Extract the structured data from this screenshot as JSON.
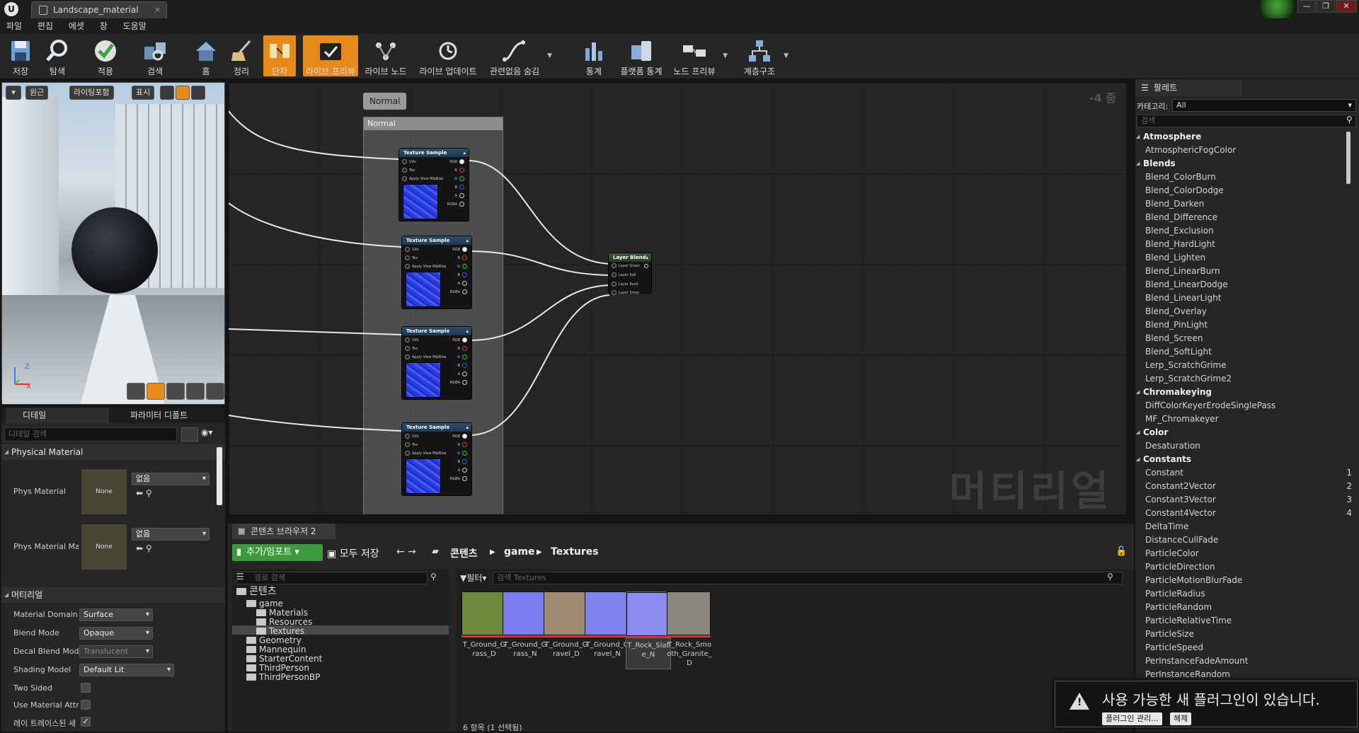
{
  "window": {
    "tab_title": "Landscape_material",
    "tab_close": "×",
    "logo": "U",
    "win_buttons": [
      "—",
      "❐",
      "✕"
    ]
  },
  "menu": [
    "파일",
    "편집",
    "에셋",
    "창",
    "도움말"
  ],
  "toolbar": [
    {
      "label": "저장",
      "icon": "save-icon"
    },
    {
      "label": "탐색",
      "icon": "browse-icon"
    },
    {
      "label": "적용",
      "icon": "apply-icon"
    },
    {
      "label": "검색",
      "icon": "find-icon"
    },
    {
      "label": "홈",
      "icon": "home-icon"
    },
    {
      "label": "정리",
      "icon": "clean-icon"
    },
    {
      "label": "단자",
      "icon": "connectors-icon",
      "active": true
    },
    {
      "label": "라이브 프리뷰",
      "icon": "live-preview-icon",
      "active": true
    },
    {
      "label": "라이브 노드",
      "icon": "live-nodes-icon"
    },
    {
      "label": "라이브 업데이트",
      "icon": "live-update-icon"
    },
    {
      "label": "관련없음 숨김",
      "icon": "hide-unrelated-icon"
    },
    {
      "label": "통계",
      "icon": "stats-icon"
    },
    {
      "label": "플랫폼 통계",
      "icon": "platform-stats-icon"
    },
    {
      "label": "노드 프리뷰",
      "icon": "node-preview-icon"
    },
    {
      "label": "계층구조",
      "icon": "hierarchy-icon"
    }
  ],
  "viewport": {
    "btn_perspective": "원근",
    "btn_lit": "라이팅포함",
    "btn_show": "표시",
    "axis_z": "Z",
    "axis_x": "X"
  },
  "details": {
    "tab_details": "디테일",
    "tab_params": "파라미터 디폴트",
    "search_placeholder": "디테일 검색",
    "section_physical": "Physical Material",
    "phys_material": {
      "label": "Phys Material",
      "thumb": "None",
      "value": "없음"
    },
    "phys_material_map": {
      "label": "Phys Material Ma",
      "thumb": "None",
      "value": "없음"
    },
    "section_material": "머티리얼",
    "material_domain": {
      "label": "Material Domain",
      "value": "Surface"
    },
    "blend_mode": {
      "label": "Blend Mode",
      "value": "Opaque"
    },
    "decal_blend_mode": {
      "label": "Decal Blend Mode",
      "value": "Translucent"
    },
    "shading_model": {
      "label": "Shading Model",
      "value": "Default Lit"
    },
    "two_sided": {
      "label": "Two Sided",
      "checked": false
    },
    "use_material_attr": {
      "label": "Use Material Attri",
      "checked": false
    },
    "raytraced": {
      "label": "레이 트레이스된 새",
      "checked": true,
      "mark": "✓"
    }
  },
  "graph": {
    "zoom": "-4 줌",
    "watermark": "머티리얼",
    "comment_tag": "Normal",
    "comment_title": "Normal",
    "texture_nodes": [
      {
        "title": "Texture Sample",
        "inputs": [
          "UVs",
          "Tex",
          "Apply View MipBias"
        ],
        "outputs": [
          "RGB",
          "R",
          "G",
          "B",
          "A",
          "RGBA"
        ]
      },
      {
        "title": "Texture Sample",
        "inputs": [
          "UVs",
          "Tex",
          "Apply View MipBias"
        ],
        "outputs": [
          "RGB",
          "R",
          "G",
          "B",
          "A",
          "RGBA"
        ]
      },
      {
        "title": "Texture Sample",
        "inputs": [
          "UVs",
          "Tex",
          "Apply View MipBias"
        ],
        "outputs": [
          "RGB",
          "R",
          "G",
          "B",
          "A",
          "RGBA"
        ]
      },
      {
        "title": "Texture Sample",
        "inputs": [
          "UVs",
          "Tex",
          "Apply View MipBias"
        ],
        "outputs": [
          "RGB",
          "R",
          "G",
          "B",
          "A",
          "RGBA"
        ]
      }
    ],
    "blend_node": {
      "title": "Layer Blend",
      "inputs": [
        "Layer Grass",
        "Layer Soil",
        "Layer Rock",
        "Layer Snow"
      ]
    }
  },
  "palette": {
    "tab": "팔레트",
    "category_label": "카테고리:",
    "category_value": "All",
    "search_placeholder": "검색",
    "rows": [
      {
        "t": "cat",
        "label": "Atmosphere"
      },
      {
        "t": "it",
        "label": "AtmosphericFogColor"
      },
      {
        "t": "cat",
        "label": "Blends"
      },
      {
        "t": "it",
        "label": "Blend_ColorBurn"
      },
      {
        "t": "it",
        "label": "Blend_ColorDodge"
      },
      {
        "t": "it",
        "label": "Blend_Darken"
      },
      {
        "t": "it",
        "label": "Blend_Difference"
      },
      {
        "t": "it",
        "label": "Blend_Exclusion"
      },
      {
        "t": "it",
        "label": "Blend_HardLight"
      },
      {
        "t": "it",
        "label": "Blend_Lighten"
      },
      {
        "t": "it",
        "label": "Blend_LinearBurn"
      },
      {
        "t": "it",
        "label": "Blend_LinearDodge"
      },
      {
        "t": "it",
        "label": "Blend_LinearLight"
      },
      {
        "t": "it",
        "label": "Blend_Overlay"
      },
      {
        "t": "it",
        "label": "Blend_PinLight"
      },
      {
        "t": "it",
        "label": "Blend_Screen"
      },
      {
        "t": "it",
        "label": "Blend_SoftLight"
      },
      {
        "t": "it",
        "label": "Lerp_ScratchGrime"
      },
      {
        "t": "it",
        "label": "Lerp_ScratchGrime2"
      },
      {
        "t": "cat",
        "label": "Chromakeying"
      },
      {
        "t": "it",
        "label": "DiffColorKeyerErodeSinglePass"
      },
      {
        "t": "it",
        "label": "MF_Chromakeyer"
      },
      {
        "t": "cat",
        "label": "Color"
      },
      {
        "t": "it",
        "label": "Desaturation"
      },
      {
        "t": "cat",
        "label": "Constants"
      },
      {
        "t": "it",
        "label": "Constant",
        "sc": "1"
      },
      {
        "t": "it",
        "label": "Constant2Vector",
        "sc": "2"
      },
      {
        "t": "it",
        "label": "Constant3Vector",
        "sc": "3"
      },
      {
        "t": "it",
        "label": "Constant4Vector",
        "sc": "4"
      },
      {
        "t": "it",
        "label": "DeltaTime"
      },
      {
        "t": "it",
        "label": "DistanceCullFade"
      },
      {
        "t": "it",
        "label": "ParticleColor"
      },
      {
        "t": "it",
        "label": "ParticleDirection"
      },
      {
        "t": "it",
        "label": "ParticleMotionBlurFade"
      },
      {
        "t": "it",
        "label": "ParticleRadius"
      },
      {
        "t": "it",
        "label": "ParticleRandom"
      },
      {
        "t": "it",
        "label": "ParticleRelativeTime"
      },
      {
        "t": "it",
        "label": "ParticleSize"
      },
      {
        "t": "it",
        "label": "ParticleSpeed"
      },
      {
        "t": "it",
        "label": "PerInstanceFadeAmount"
      },
      {
        "t": "it",
        "label": "PerInstanceRandom"
      }
    ]
  },
  "content_browser": {
    "tab": "콘텐츠 브라우저 2",
    "add_import": "추가/임포트",
    "save_all": "모두 저장",
    "breadcrumb": [
      "콘텐츠",
      "game",
      "Textures"
    ],
    "path_search": "경로 검색",
    "filter": "필터",
    "asset_search": "검색 Textures",
    "tree": [
      {
        "label": "콘텐츠",
        "depth": 0,
        "big": true
      },
      {
        "label": "game",
        "depth": 1
      },
      {
        "label": "Materials",
        "depth": 2
      },
      {
        "label": "Resources",
        "depth": 2
      },
      {
        "label": "Textures",
        "depth": 2,
        "selected": true
      },
      {
        "label": "Geometry",
        "depth": 1
      },
      {
        "label": "Mannequin",
        "depth": 1
      },
      {
        "label": "StarterContent",
        "depth": 1
      },
      {
        "label": "ThirdPerson",
        "depth": 1
      },
      {
        "label": "ThirdPersonBP",
        "depth": 1
      }
    ],
    "assets": [
      {
        "name": "T_Ground_Grass_D",
        "color": "#6b8a3a"
      },
      {
        "name": "T_Ground_Grass_N",
        "color": "#7a7cf0"
      },
      {
        "name": "T_Ground_Gravel_D",
        "color": "#a08c72"
      },
      {
        "name": "T_Ground_Gravel_N",
        "color": "#7f82ef"
      },
      {
        "name": "T_Rock_Slate_N",
        "color": "#8a8cf2",
        "selected": true
      },
      {
        "name": "T_Rock_Smooth_Granite_D",
        "color": "#8a8780"
      }
    ],
    "count": "6 항목 (1 선택됨)"
  },
  "notification": {
    "text": "사용 가능한 새 플러그인이 있습니다.",
    "btn_manage": "플러그인 관리...",
    "btn_dismiss": "해제"
  }
}
